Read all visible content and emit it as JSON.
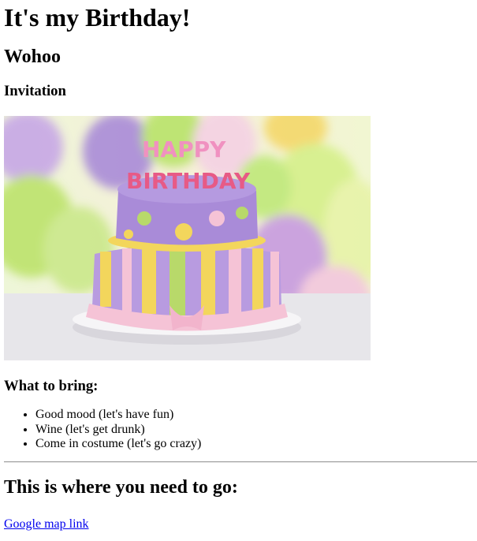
{
  "page": {
    "title": "It's my Birthday!",
    "subtitle": "Wohoo",
    "invitation_heading": "Invitation",
    "image_alt": "Happy birthday cake with balloons",
    "cake_topper": [
      "HAPPY",
      "BIRTHDAY"
    ],
    "bring_heading": "What to bring:",
    "bring_items": [
      "Good mood (let's have fun)",
      "Wine (let's get drunk)",
      "Come in costume (let's go crazy)"
    ],
    "directions_heading": "This is where you need to go:",
    "map_link_text": "Google map link"
  },
  "colors": {
    "link": "#0000ee",
    "cake_purple": "#b08fd6",
    "cake_pink": "#f5c3d6",
    "cake_yellow": "#f3d65c",
    "cake_green": "#b8d96a"
  }
}
